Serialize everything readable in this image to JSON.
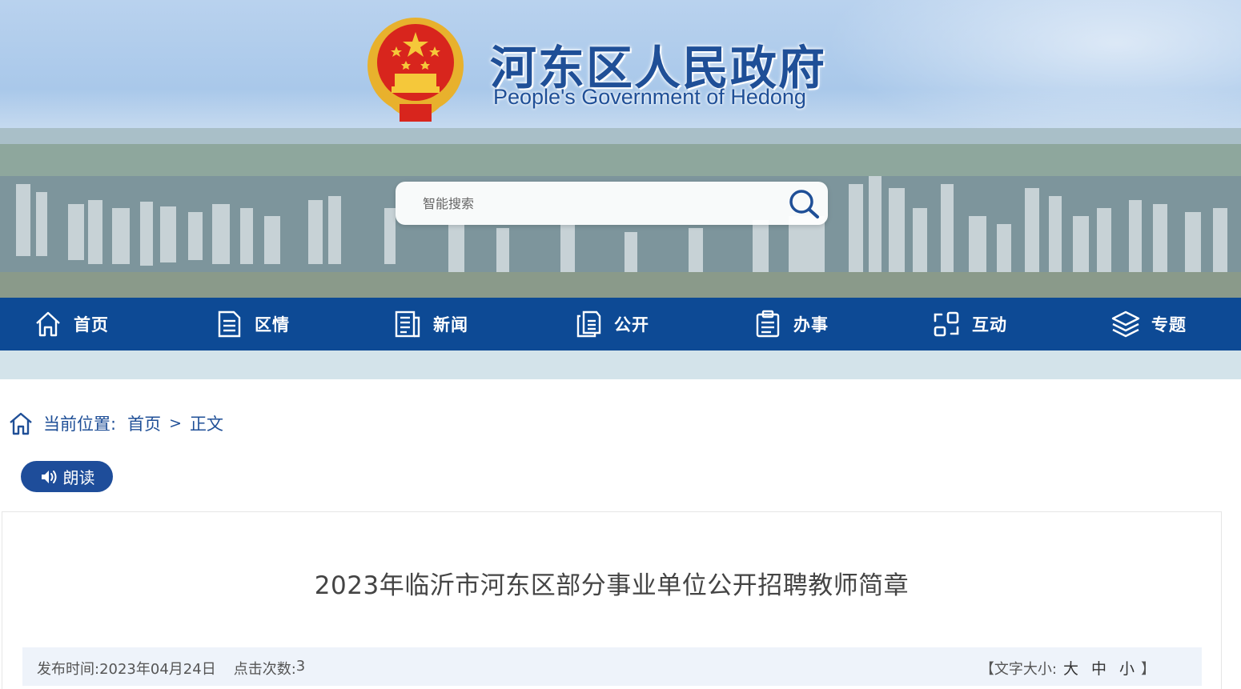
{
  "header": {
    "title_cn": "河东区人民政府",
    "title_en": "People's Government of Hedong",
    "search": {
      "placeholder": "智能搜索"
    }
  },
  "nav": {
    "items": [
      {
        "label": "首页",
        "icon": "home-icon"
      },
      {
        "label": "区情",
        "icon": "document-icon"
      },
      {
        "label": "新闻",
        "icon": "news-icon"
      },
      {
        "label": "公开",
        "icon": "files-icon"
      },
      {
        "label": "办事",
        "icon": "clipboard-icon"
      },
      {
        "label": "互动",
        "icon": "interaction-icon"
      },
      {
        "label": "专题",
        "icon": "layers-icon"
      }
    ]
  },
  "breadcrumb": {
    "prefix": "当前位置:",
    "home": "首页",
    "separator": ">",
    "current": "正文"
  },
  "read_aloud": {
    "label": "朗读"
  },
  "article": {
    "title": "2023年临沂市河东区部分事业单位公开招聘教师简章",
    "publish_label": "发布时间:",
    "publish_date": "2023年04月24日",
    "clicks_label": "点击次数:",
    "clicks": "3",
    "font_size_prefix": "【文字大小:",
    "font_large": "大",
    "font_medium": "中",
    "font_small": "小",
    "font_size_suffix": "】"
  },
  "colors": {
    "nav_bg": "#0d4a95",
    "subbar_bg": "#d3e3ea",
    "title_blue": "#1f4f97",
    "meta_bg": "#eef3fa"
  }
}
